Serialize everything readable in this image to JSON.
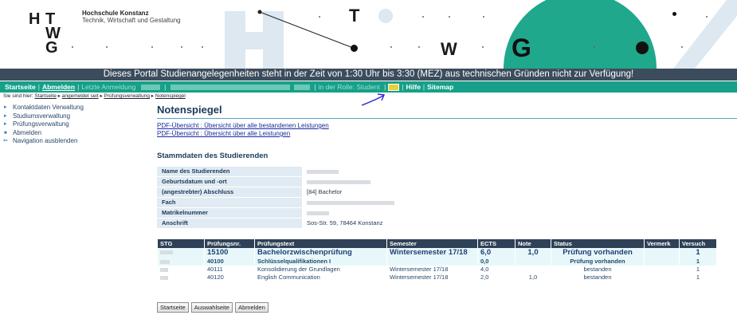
{
  "header": {
    "logo_letters": [
      "H",
      "T",
      "W",
      "G"
    ],
    "uni_name": "Hochschule Konstanz",
    "uni_subtitle": "Technik, Wirtschaft und Gestaltung",
    "deco_letters": {
      "t": "T",
      "w": "W",
      "g": "G"
    },
    "colors": {
      "accent_green": "#1fa88c",
      "light_blue": "#dde8f1"
    }
  },
  "notice": "Dieses Portal Studienangelegenheiten steht in der Zeit von 1:30 Uhr bis 3:30 (MEZ) aus technischen Gründen nicht zur Verfügung!",
  "topnav": {
    "start": "Startseite",
    "logout": "Abmelden",
    "last_login": "Letzte Anmeldung",
    "role": "in der Rolle: Student",
    "help": "Hilfe",
    "sitemap": "Sitemap"
  },
  "breadcrumb": {
    "prefix": "Sie sind hier:",
    "items": [
      "Startseite",
      "angemeldet seit",
      "Prüfungsverwaltung",
      "Notenspiegel"
    ]
  },
  "sidebar": {
    "items": [
      {
        "label": "Kontaktdaten Verwaltung",
        "icon": "triangle-right-icon"
      },
      {
        "label": "Studiumsverwaltung",
        "icon": "triangle-right-icon"
      },
      {
        "label": "Prüfungsverwaltung",
        "icon": "triangle-right-icon"
      },
      {
        "label": "Abmelden",
        "icon": "square-bullet-icon"
      },
      {
        "label": "Navigation ausblenden",
        "icon": "arrows-icon"
      }
    ]
  },
  "main": {
    "title": "Notenspiegel",
    "pdf_links": [
      "PDF-Übersicht : Übersicht über alle bestandenen Leistungen",
      "PDF-Übersicht : Übersicht über alle Leistungen"
    ],
    "stamm_title": "Stammdaten des Studierenden",
    "stamm": [
      {
        "label": "Name des Studierenden",
        "value": ""
      },
      {
        "label": "Geburtsdatum und -ort",
        "value": ""
      },
      {
        "label": "(angestrebter) Abschluss",
        "value": "[84] Bachelor"
      },
      {
        "label": "Fach",
        "value": ""
      },
      {
        "label": "Matrikelnummer",
        "value": ""
      },
      {
        "label": "Anschrift",
        "value": "Sos-Str. 59, 78464 Konstanz"
      }
    ]
  },
  "grades": {
    "headers": [
      "STG",
      "Prüfungsnr.",
      "Prüfungstext",
      "Semester",
      "ECTS",
      "Note",
      "Status",
      "Vermerk",
      "Versuch"
    ],
    "rows": [
      {
        "stg": "",
        "nr": "15100",
        "text": "Bachelorzwischenprüfung",
        "semester": "Wintersemester 17/18",
        "ects": "6,0",
        "note": "1,0",
        "status": "Prüfung vorhanden",
        "vermerk": "",
        "versuch": "1"
      },
      {
        "stg": "",
        "nr": "40100",
        "text": "Schlüsselqualifikationen I",
        "semester": "",
        "ects": "0,0",
        "note": "",
        "status": "Prüfung vorhanden",
        "vermerk": "",
        "versuch": "1"
      },
      {
        "stg": "",
        "nr": "40111",
        "text": "Konsolidierung der Grundlagen",
        "semester": "Wintersemester 17/18",
        "ects": "4,0",
        "note": "",
        "status": "bestanden",
        "vermerk": "",
        "versuch": "1"
      },
      {
        "stg": "",
        "nr": "40120",
        "text": "English Communication",
        "semester": "Wintersemester 17/18",
        "ects": "2,0",
        "note": "1,0",
        "status": "bestanden",
        "vermerk": "",
        "versuch": "1"
      }
    ]
  },
  "buttons": {
    "start": "Startseite",
    "selection": "Auswahlseite",
    "logout": "Abmelden"
  }
}
